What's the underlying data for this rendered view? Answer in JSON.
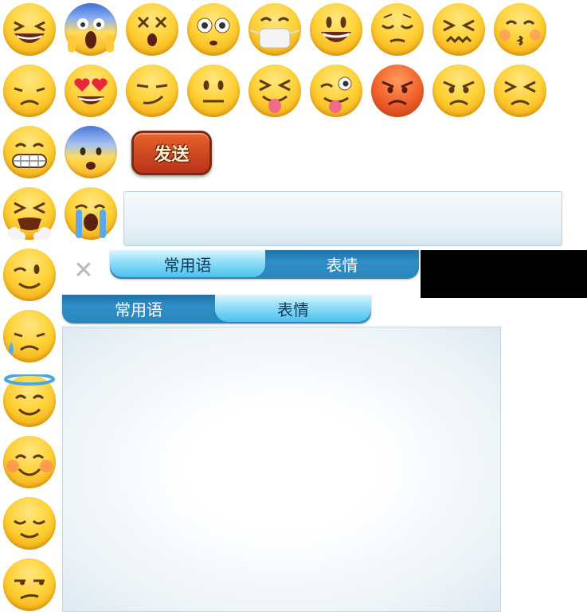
{
  "send_button": {
    "label": "发送"
  },
  "input": {
    "value": ""
  },
  "tabs_top": [
    {
      "label": "常用语",
      "active": true
    },
    {
      "label": "表情",
      "active": false
    }
  ],
  "tabs_bottom": [
    {
      "label": "常用语",
      "active": false
    },
    {
      "label": "表情",
      "active": true
    }
  ],
  "close_icon": {
    "glyph": "✕",
    "icon": "close-icon"
  },
  "emojis": [
    "laughing-face-icon",
    "screaming-face-icon",
    "dizzy-face-icon",
    "flushed-face-icon",
    "mask-face-icon",
    "smiley-face-icon",
    "pensive-face-icon",
    "confounded-face-icon",
    "kissing-face-icon",
    "disappointed-face-icon",
    "heart-eyes-face-icon",
    "smirking-face-icon",
    "neutral-face-icon",
    "tongue-squint-face-icon",
    "tongue-wink-face-icon",
    "angry-red-face-icon",
    "angry-face-icon",
    "persevering-face-icon",
    "grimacing-face-icon",
    "fearful-face-icon",
    "crying-steam-face-icon",
    "loudly-crying-face-icon",
    "winking-face-icon",
    "sweat-face-icon",
    "angel-face-icon",
    "blushing-face-icon",
    "relieved-face-icon",
    "unamused-face-icon"
  ],
  "colors": {
    "tab_bar": "#2a86bd",
    "tab_active": "#8fdcf7",
    "send_button": "#d64d22"
  }
}
